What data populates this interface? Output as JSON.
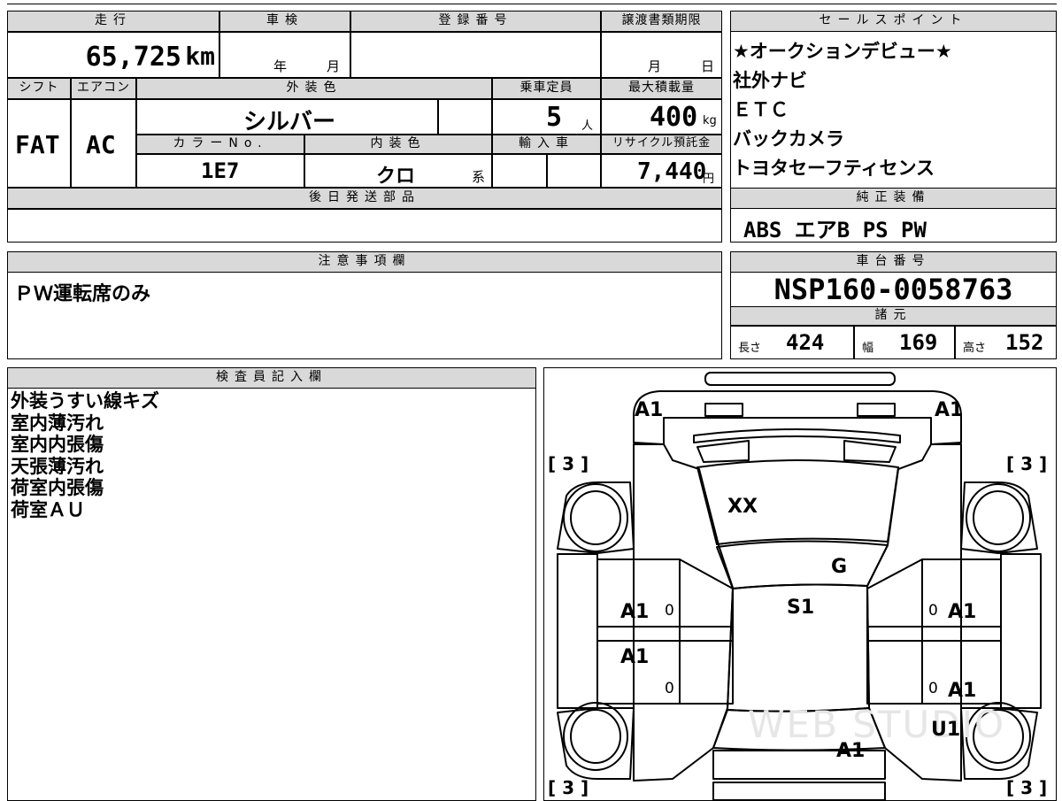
{
  "basic": {
    "mileage_label": "走行",
    "mileage_value": "65,725",
    "mileage_unit": "km",
    "shaken_label": "車検",
    "shaken_year_unit": "年",
    "shaken_month_unit": "月",
    "registration_label": "登録番号",
    "transfer_deadline_label": "譲渡書類期限",
    "transfer_month_unit": "月",
    "transfer_day_unit": "日"
  },
  "spec": {
    "shift_label": "シフト",
    "shift_value": "FAT",
    "aircon_label": "エアコン",
    "aircon_value": "AC",
    "exterior_color_label": "外装色",
    "exterior_color_value": "シルバー",
    "capacity_label": "乗車定員",
    "capacity_value": "5",
    "capacity_unit": "人",
    "max_load_label": "最大積載量",
    "max_load_value": "400",
    "max_load_unit": "kg",
    "color_no_label": "カラーNo.",
    "color_no_value": "1E7",
    "interior_color_label": "内装色",
    "interior_color_value": "クロ",
    "interior_color_suffix": "系",
    "import_label": "輸入車",
    "recycle_label": "リサイクル預託金",
    "recycle_value": "7,440",
    "recycle_unit": "円",
    "later_parts_label": "後日発送部品"
  },
  "sales_points": {
    "label": "セールスポイント",
    "items": [
      "★オークションデビュー★",
      "社外ナビ",
      "ＥＴＣ",
      "バックカメラ",
      "トヨタセーフティセンス"
    ]
  },
  "genuine_equipment": {
    "label": "純正装備",
    "value": "ABS エアB PS PW"
  },
  "notes": {
    "label": "注意事項欄",
    "value": "ＰＷ運転席のみ"
  },
  "chassis": {
    "label": "車台番号",
    "value": "NSP160-0058763",
    "dims_label": "諸元",
    "length_label": "長さ",
    "length_value": "424",
    "width_label": "幅",
    "width_value": "169",
    "height_label": "高さ",
    "height_value": "152"
  },
  "inspector": {
    "label": "検査員記入欄",
    "lines": [
      "外装うすい線キズ",
      "室内薄汚れ",
      "室内内張傷",
      "天張薄汚れ",
      "荷室内張傷",
      "荷室ＡＵ"
    ]
  },
  "diagram": {
    "marks": {
      "front_left": "A1",
      "front_right": "A1",
      "hood": "XX",
      "windshield": "G",
      "roof": "S1",
      "left_front_door": "A1",
      "right_front_door": "A1",
      "left_rear_door": "A1",
      "right_rear_door": "A1",
      "rear_right": "U1",
      "rear_hatch": "A1",
      "tire_fl": "[ 3 ]",
      "tire_fr": "[ 3 ]",
      "tire_rl": "[ 3 ]",
      "tire_rr": "[ 3 ]",
      "zero_1": "0",
      "zero_2": "0",
      "zero_3": "0",
      "zero_4": "0"
    },
    "watermark": "WEB STUDIO",
    "line_color": "#000000"
  },
  "colors": {
    "header_bg": "#d9d9d9",
    "border": "#000000"
  }
}
